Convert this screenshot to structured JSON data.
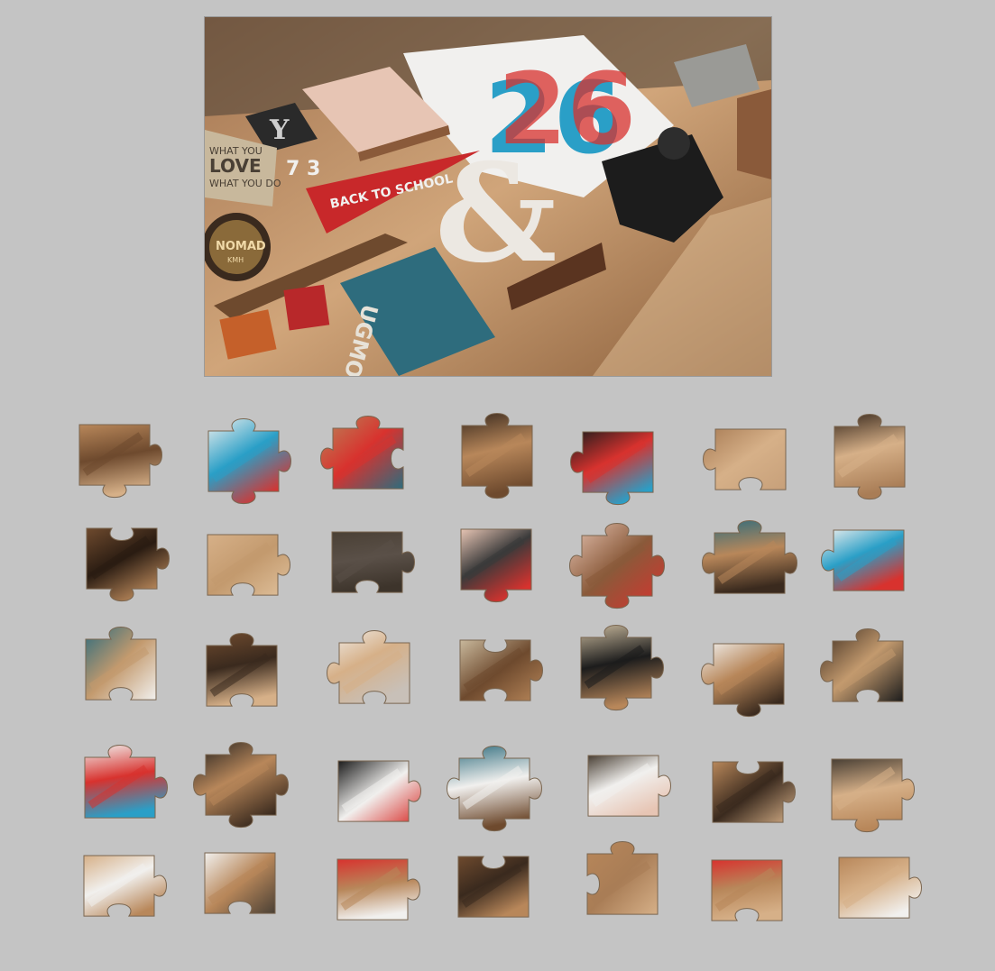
{
  "puzzle": {
    "reference_labels": {
      "pennant": "BACK TO SCHOOL",
      "book_sign": "UGMONK",
      "card_line1": "WHAT YOU",
      "card_line2": "LOVE",
      "card_line3": "WHAT YOU DO",
      "badge": "NOMAD",
      "badge_sub": "KMH",
      "shirt_number": "26",
      "block_letter": "Y",
      "numbers": "7 3",
      "ampersand": "&"
    },
    "colors": {
      "background": "#c4c4c4",
      "wood_light": "#d6b088",
      "wood_mid": "#b8875a",
      "wood_dark": "#6e4a2e",
      "shirt_white": "#f1f0ee",
      "accent_blue": "#2a9fc7",
      "accent_red": "#d8322e",
      "teal_book": "#2e6c7d",
      "leather_pink": "#e7c5b4",
      "camera_black": "#1c1c1c",
      "wall_shadow": "#4a4035"
    },
    "pieces": [
      {
        "name": "piece-r1c1",
        "palette": [
          "#b8875a",
          "#6e4a2e",
          "#d6b088"
        ],
        "tabs": [
          0,
          1,
          1,
          0
        ]
      },
      {
        "name": "piece-r1c2",
        "palette": [
          "#f1f0ee",
          "#2a9fc7",
          "#d8322e"
        ],
        "tabs": [
          1,
          1,
          1,
          0
        ]
      },
      {
        "name": "piece-r1c3",
        "palette": [
          "#b8875a",
          "#d8322e",
          "#2e6c7d"
        ],
        "tabs": [
          1,
          -1,
          0,
          1
        ]
      },
      {
        "name": "piece-r1c4",
        "palette": [
          "#3a2a1e",
          "#b8875a",
          "#6e4a2e"
        ],
        "tabs": [
          1,
          0,
          1,
          0
        ]
      },
      {
        "name": "piece-r1c5",
        "palette": [
          "#1c1c1c",
          "#d8322e",
          "#2a9fc7"
        ],
        "tabs": [
          0,
          0,
          1,
          1
        ]
      },
      {
        "name": "piece-r1c6",
        "palette": [
          "#a97d56",
          "#d6b088",
          "#c7a07a"
        ],
        "tabs": [
          0,
          0,
          -1,
          1
        ]
      },
      {
        "name": "piece-r1c7",
        "palette": [
          "#3a2a1e",
          "#d6b088",
          "#a97d56"
        ],
        "tabs": [
          1,
          0,
          1,
          0
        ]
      },
      {
        "name": "piece-r2c1",
        "palette": [
          "#6e4a2e",
          "#2a1c12",
          "#b8875a"
        ],
        "tabs": [
          -1,
          1,
          1,
          0
        ]
      },
      {
        "name": "piece-r2c2",
        "palette": [
          "#d6b088",
          "#c39a6e",
          "#e0c19c"
        ],
        "tabs": [
          0,
          1,
          -1,
          0
        ]
      },
      {
        "name": "piece-r2c3",
        "palette": [
          "#4a4035",
          "#5a5048",
          "#3d342b"
        ],
        "tabs": [
          0,
          1,
          -1,
          0
        ]
      },
      {
        "name": "piece-r2c4",
        "palette": [
          "#e7c5b4",
          "#3a3a3a",
          "#d8322e"
        ],
        "tabs": [
          0,
          0,
          1,
          0
        ]
      },
      {
        "name": "piece-r2c5",
        "palette": [
          "#e7c5b4",
          "#8a5a3a",
          "#d8322e"
        ],
        "tabs": [
          1,
          1,
          1,
          1
        ]
      },
      {
        "name": "piece-r2c6",
        "palette": [
          "#2e6c7d",
          "#b8875a",
          "#3a2a1e"
        ],
        "tabs": [
          1,
          1,
          0,
          1
        ]
      },
      {
        "name": "piece-r2c7",
        "palette": [
          "#f1f0ee",
          "#2a9fc7",
          "#d8322e"
        ],
        "tabs": [
          0,
          0,
          0,
          1
        ]
      },
      {
        "name": "piece-r3c1",
        "palette": [
          "#2e6c7d",
          "#c39a6e",
          "#f1f0ee"
        ],
        "tabs": [
          1,
          0,
          -1,
          0
        ]
      },
      {
        "name": "piece-r3c2",
        "palette": [
          "#6e4a2e",
          "#3a2a1e",
          "#d6b088"
        ],
        "tabs": [
          1,
          0,
          -1,
          0
        ]
      },
      {
        "name": "piece-r3c3",
        "palette": [
          "#f1f0ee",
          "#d6b088",
          "#c8c0b8"
        ],
        "tabs": [
          1,
          0,
          -1,
          1
        ]
      },
      {
        "name": "piece-r3c4",
        "palette": [
          "#c8b89c",
          "#6e4a2e",
          "#b8875a"
        ],
        "tabs": [
          -1,
          1,
          -1,
          0
        ]
      },
      {
        "name": "piece-r3c5",
        "palette": [
          "#c8b89c",
          "#1c1c1c",
          "#b8875a"
        ],
        "tabs": [
          1,
          1,
          1,
          0
        ]
      },
      {
        "name": "piece-r3c6",
        "palette": [
          "#f1f0ee",
          "#b8875a",
          "#3a2a1e"
        ],
        "tabs": [
          0,
          0,
          1,
          1
        ]
      },
      {
        "name": "piece-r3c7",
        "palette": [
          "#3a2a1e",
          "#c39a6e",
          "#1c1c1c"
        ],
        "tabs": [
          1,
          0,
          -1,
          1
        ]
      },
      {
        "name": "piece-r4c1",
        "palette": [
          "#f1f0ee",
          "#d8322e",
          "#2a9fc7"
        ],
        "tabs": [
          1,
          1,
          0,
          0
        ]
      },
      {
        "name": "piece-r4c2",
        "palette": [
          "#1c1c1c",
          "#b8875a",
          "#3a2a1e"
        ],
        "tabs": [
          1,
          1,
          1,
          1
        ]
      },
      {
        "name": "piece-r4c3",
        "palette": [
          "#1c1c1c",
          "#f1f0ee",
          "#d8322e"
        ],
        "tabs": [
          0,
          1,
          0,
          0
        ]
      },
      {
        "name": "piece-r4c4",
        "palette": [
          "#2e6c7d",
          "#f1f0ee",
          "#6e4a2e"
        ],
        "tabs": [
          1,
          1,
          1,
          1
        ]
      },
      {
        "name": "piece-r4c5",
        "palette": [
          "#4a4035",
          "#f1f0ee",
          "#e7c5b4"
        ],
        "tabs": [
          0,
          1,
          0,
          0
        ]
      },
      {
        "name": "piece-r4c6",
        "palette": [
          "#b8875a",
          "#3a2a1e",
          "#d6b088"
        ],
        "tabs": [
          -1,
          1,
          0,
          0
        ]
      },
      {
        "name": "piece-r4c7",
        "palette": [
          "#4a4035",
          "#d6b088",
          "#b8875a"
        ],
        "tabs": [
          0,
          1,
          1,
          0
        ]
      },
      {
        "name": "piece-r5c1",
        "palette": [
          "#d6b088",
          "#f1f0ee",
          "#b8875a"
        ],
        "tabs": [
          0,
          1,
          -1,
          0
        ]
      },
      {
        "name": "piece-r5c2",
        "palette": [
          "#f1f0ee",
          "#b8875a",
          "#4a4035"
        ],
        "tabs": [
          0,
          0,
          -1,
          0
        ]
      },
      {
        "name": "piece-r5c3",
        "palette": [
          "#d8322e",
          "#b8875a",
          "#f1f0ee"
        ],
        "tabs": [
          0,
          1,
          0,
          0
        ]
      },
      {
        "name": "piece-r5c4",
        "palette": [
          "#6e4a2e",
          "#3a2a1e",
          "#b8875a"
        ],
        "tabs": [
          -1,
          0,
          0,
          0
        ]
      },
      {
        "name": "piece-r5c5",
        "palette": [
          "#b8875a",
          "#a97d56",
          "#d6b088"
        ],
        "tabs": [
          1,
          0,
          0,
          -1
        ]
      },
      {
        "name": "piece-r5c6",
        "palette": [
          "#d8322e",
          "#b8875a",
          "#d6b088"
        ],
        "tabs": [
          0,
          0,
          -1,
          0
        ]
      },
      {
        "name": "piece-r5c7",
        "palette": [
          "#b8875a",
          "#d6b088",
          "#f1f0ee"
        ],
        "tabs": [
          0,
          1,
          0,
          0
        ]
      }
    ]
  }
}
